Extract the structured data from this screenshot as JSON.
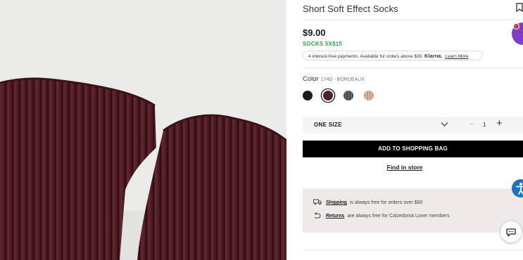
{
  "product": {
    "title": "Short Soft Effect Socks",
    "price": "$9.00",
    "promo": "SOCKS 5X$15",
    "klarna": {
      "text": "4 interest-free payments. Available for orders above $35.",
      "brand": "Klarna.",
      "link": "Learn More"
    }
  },
  "color": {
    "label": "Color",
    "selected": "174D - BORDEAUX",
    "swatches": [
      {
        "name": "black",
        "hex": "#1a1a1a"
      },
      {
        "name": "bordeaux",
        "hex": "#4a2228"
      },
      {
        "name": "grey",
        "hex": "#5b5b5b"
      },
      {
        "name": "beige",
        "hex": "#c8a58e"
      }
    ]
  },
  "size": {
    "label": "ONE SIZE"
  },
  "quantity": {
    "value": "1",
    "minus": "−",
    "plus": "+"
  },
  "actions": {
    "add_to_bag": "ADD TO SHOPPING BAG",
    "find_in_store": "Find in store"
  },
  "info": {
    "shipping_link": "Shipping",
    "shipping_text": "is always free for orders over $60",
    "returns_link": "Returns",
    "returns_text": "are always free for Calzedonia Lover members"
  },
  "colors": {
    "promo_green": "#2fa84f",
    "button_bg": "#000000",
    "info_bg": "#efeaea",
    "accessibility_blue": "#1c70c6"
  }
}
